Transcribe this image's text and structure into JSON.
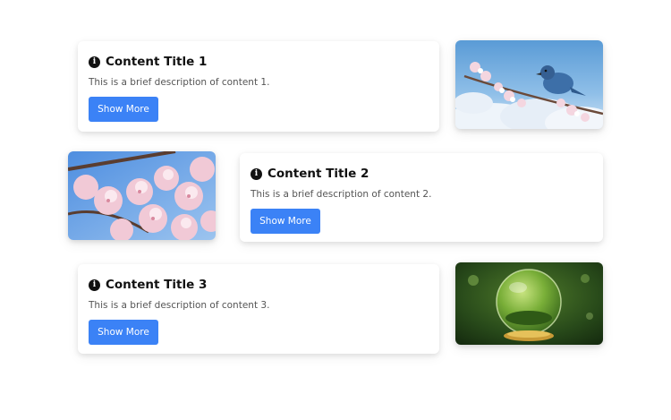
{
  "cards": [
    {
      "icon": "info-circle-icon",
      "title": "Content Title 1",
      "description": "This is a brief description of content 1.",
      "button_label": "Show More",
      "image": "bird-cherry-blossom-image"
    },
    {
      "icon": "info-circle-icon",
      "title": "Content Title 2",
      "description": "This is a brief description of content 2.",
      "button_label": "Show More",
      "image": "cherry-blossom-image"
    },
    {
      "icon": "info-circle-icon",
      "title": "Content Title 3",
      "description": "This is a brief description of content 3.",
      "button_label": "Show More",
      "image": "terrarium-globe-image"
    }
  ],
  "colors": {
    "button": "#3b82f6",
    "title": "#111111",
    "description": "#555555"
  }
}
